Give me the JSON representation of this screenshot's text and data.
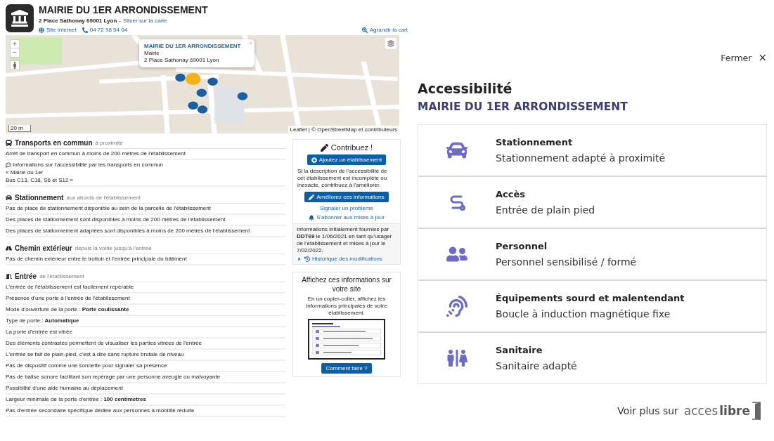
{
  "header": {
    "title": "MAIRIE DU 1ER ARRONDISSEMENT",
    "address": "2 Place Sathonay 69001 Lyon",
    "separator": "-",
    "map_link": "Situer sur la carte",
    "website": "Site internet",
    "phone": "04 72 98 54 04",
    "enlarge_map": "Agrandir la cart"
  },
  "map": {
    "zoom_in": "+",
    "zoom_out": "−",
    "popup": {
      "title": "MAIRIE DU 1ER ARRONDISSEMENT",
      "kind": "Mairie",
      "address": "2 Place Sathonay 69001 Lyon",
      "close": "×"
    },
    "scale": "20 m",
    "attribution": "Leaflet | © OpenStreetMap et contributeurs"
  },
  "sections": [
    {
      "kind": "bus",
      "title": "Transports en commun",
      "subtitle": "à proximité",
      "rows": [
        {
          "kind": "text",
          "text": "Arrêt de transport en commun à moins de 200 mètres de l'établissement"
        },
        {
          "kind": "note",
          "text": "Informations sur l'accessibilité par les transports en commun",
          "lines": [
            "« Mairie du 1er",
            "Bus C13, C18, S6 et S12 »"
          ]
        }
      ]
    },
    {
      "kind": "car",
      "title": "Stationnement",
      "subtitle": "aux abords de l'établissement",
      "rows": [
        {
          "kind": "text",
          "text": "Pas de place de stationnement disponible au sein de la parcelle de l'établissement"
        },
        {
          "kind": "text",
          "text": "Des places de stationnement sont disponibles à moins de 200 mètres de l'établissement"
        },
        {
          "kind": "text",
          "text": "Des places de stationnement adaptées sont disponibles à moins de 200 mètres de l'établissement"
        }
      ]
    },
    {
      "kind": "road",
      "title": "Chemin extérieur",
      "subtitle": "depuis la voirie jusqu'à l'entrée",
      "rows": [
        {
          "kind": "text",
          "text": "Pas de chemin extérieur entre le trottoir et l'entrée principale du bâtiment"
        }
      ]
    },
    {
      "kind": "door",
      "title": "Entrée",
      "subtitle": "de l'établissement",
      "rows": [
        {
          "kind": "text",
          "text": "L'entrée de l'établissement est facilement repérable"
        },
        {
          "kind": "text",
          "text": "Présence d'une porte à l'entrée de l'établissement"
        },
        {
          "kind": "text",
          "text": "Mode d'ouverture de la porte : **Porte coulissante**"
        },
        {
          "kind": "text",
          "text": "Type de porte : **Automatique**"
        },
        {
          "kind": "text",
          "text": "La porte d'entrée est vitrée"
        },
        {
          "kind": "text",
          "text": "Des éléments contrastés permettent de visualiser les parties vitrées de l'entrée"
        },
        {
          "kind": "text",
          "text": "L'entrée se fait de plain-pied, c'est à dire sans rupture brutale de niveau"
        },
        {
          "kind": "text",
          "text": "Pas de dispositif comme une sonnette pour signaler sa présence"
        },
        {
          "kind": "text",
          "text": "Pas de balise sonore facilitant son repérage par une personne aveugle ou malvoyante"
        },
        {
          "kind": "text",
          "text": "Possibilité d'une aide humaine au déplacement"
        },
        {
          "kind": "text",
          "text": "Largeur minimale de la porte d'entrée : **100 centimètres**"
        },
        {
          "kind": "text",
          "text": "Pas d'entrée secondaire spécifique dédiée aux personnes à mobilité réduite"
        }
      ]
    }
  ],
  "contribute": {
    "title": "Contribuez !",
    "add_button": "Ajoutez un établissement",
    "description": "Si la description de l'accessibilité de cet établissement est incomplète ou inexacte, contribuez à l'améliorer.",
    "improve_button": "Améliorez ces informations",
    "report_link": "Signaler un problème",
    "subscribe_link": "S'abonner aux mises à jour",
    "source": "Informations initialement fournies par **DDT69** le 1/06/2021 en tant qu'usager de l'établissement et mises à jour le 7/02/2022.",
    "history_link": "Historique des modifications"
  },
  "embed": {
    "title": "Affichez ces informations sur votre site",
    "description": "En un copier-coller, affichez les informations principales de votre établissement.",
    "button": "Comment faire ?"
  },
  "widget": {
    "close": "Fermer",
    "close_icon": "×",
    "title": "Accessibilité",
    "subtitle": "MAIRIE DU 1ER ARRONDISSEMENT",
    "items": [
      {
        "kind": "car",
        "title": "Stationnement",
        "description": "Stationnement adapté à proximité"
      },
      {
        "kind": "path",
        "title": "Accès",
        "description": "Entrée de plain pied"
      },
      {
        "kind": "people",
        "title": "Personnel",
        "description": "Personnel sensibilisé / formé"
      },
      {
        "kind": "ear",
        "title": "Équipements sourd et malentendant",
        "description": "Boucle à induction magnétique fixe"
      },
      {
        "kind": "toilet",
        "title": "Sanitaire",
        "description": "Sanitaire adapté"
      }
    ],
    "more": "Voir plus sur",
    "logo_light": "acces",
    "logo_bold": "libre"
  }
}
